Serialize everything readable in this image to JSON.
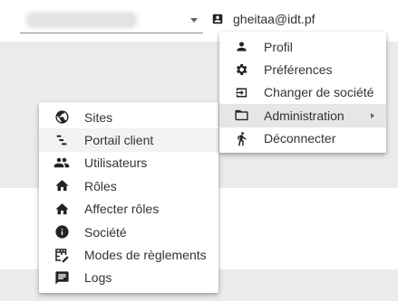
{
  "header": {
    "select_value": "",
    "user_email": "gheitaa@idt.pf"
  },
  "user_menu": {
    "items": [
      {
        "label": "Profil",
        "icon": "person-icon"
      },
      {
        "label": "Préférences",
        "icon": "gear-icon"
      },
      {
        "label": "Changer de société",
        "icon": "switch-icon"
      },
      {
        "label": "Administration",
        "icon": "folder-icon"
      },
      {
        "label": "Déconnecter",
        "icon": "running-person-icon"
      }
    ]
  },
  "admin_menu": {
    "items": [
      {
        "label": "Sites",
        "icon": "globe-icon"
      },
      {
        "label": "Portail client",
        "icon": "sort-lines-icon"
      },
      {
        "label": "Utilisateurs",
        "icon": "people-icon"
      },
      {
        "label": "Rôles",
        "icon": "home-icon"
      },
      {
        "label": "Affecter rôles",
        "icon": "home-icon"
      },
      {
        "label": "Société",
        "icon": "info-icon"
      },
      {
        "label": "Modes de règlements",
        "icon": "table-edit-icon"
      },
      {
        "label": "Logs",
        "icon": "chat-icon"
      }
    ]
  },
  "colors": {
    "background": "#ebebeb",
    "active_item": "#e6e6e6",
    "hover_item": "#f3f3f3"
  }
}
